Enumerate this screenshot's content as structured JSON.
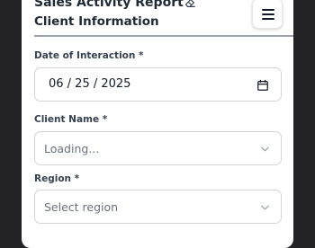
{
  "header": {
    "report_title": "Sales Activity Report",
    "title_icon": "eraser-icon",
    "menu_icon": "hamburger-menu-icon"
  },
  "section": {
    "title": "Client Information"
  },
  "form": {
    "date": {
      "label": "Date of Interaction *",
      "value": "06 / 25 / 2025",
      "icon": "calendar-icon"
    },
    "client": {
      "label": "Client Name *",
      "placeholder": "Loading...",
      "icon": "chevron-down-icon"
    },
    "region": {
      "label": "Region *",
      "placeholder": "Select region",
      "icon": "chevron-down-icon"
    }
  },
  "colors": {
    "background": "#232325",
    "card": "#ffffff",
    "text": "#1f2937",
    "border": "#d1d5db",
    "placeholder": "#6b7280"
  }
}
